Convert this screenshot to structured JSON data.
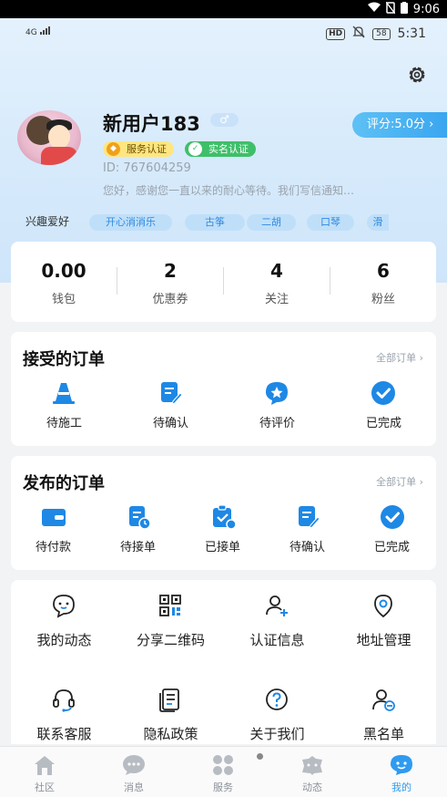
{
  "system_bar": {
    "time": "9:06"
  },
  "status": {
    "signal": "4G",
    "hd": "HD",
    "battery": "58",
    "time": "5:31"
  },
  "profile": {
    "name": "新用户183",
    "gender_symbol": "♂",
    "badges": {
      "service": "服务认证",
      "real_name": "实名认证"
    },
    "uid": "ID: 767604259",
    "signature": "您好，感谢您一直以来的耐心等待。我们写信通知…",
    "score": "评分:5.0分 ›"
  },
  "hobbies": {
    "label": "兴趣爱好",
    "tags": [
      "开心消消乐",
      "古筝",
      "二胡",
      "口琴",
      "滑"
    ]
  },
  "stats": [
    {
      "value": "0.00",
      "label": "钱包"
    },
    {
      "value": "2",
      "label": "优惠券"
    },
    {
      "value": "4",
      "label": "关注"
    },
    {
      "value": "6",
      "label": "粉丝"
    }
  ],
  "received_orders": {
    "title": "接受的订单",
    "all_link": "全部订单  ›",
    "items": [
      {
        "label": "待施工",
        "icon": "traffic-cone-icon"
      },
      {
        "label": "待确认",
        "icon": "edit-document-icon"
      },
      {
        "label": "待评价",
        "icon": "star-bubble-icon"
      },
      {
        "label": "已完成",
        "icon": "check-circle-icon"
      }
    ]
  },
  "published_orders": {
    "title": "发布的订单",
    "all_link": "全部订单  ›",
    "items": [
      {
        "label": "待付款",
        "icon": "wallet-icon"
      },
      {
        "label": "待接单",
        "icon": "clock-document-icon"
      },
      {
        "label": "已接单",
        "icon": "clipboard-icon"
      },
      {
        "label": "待确认",
        "icon": "edit-document-icon"
      },
      {
        "label": "已完成",
        "icon": "check-circle-icon"
      }
    ]
  },
  "tools": [
    {
      "label": "我的动态",
      "icon": "chat-face-icon"
    },
    {
      "label": "分享二维码",
      "icon": "qr-code-icon"
    },
    {
      "label": "认证信息",
      "icon": "user-add-icon"
    },
    {
      "label": "地址管理",
      "icon": "location-icon"
    },
    {
      "label": "联系客服",
      "icon": "headset-icon"
    },
    {
      "label": "隐私政策",
      "icon": "document-icon"
    },
    {
      "label": "关于我们",
      "icon": "question-icon"
    },
    {
      "label": "黑名单",
      "icon": "user-block-icon"
    }
  ],
  "tabbar": [
    {
      "label": "社区",
      "icon": "home-icon"
    },
    {
      "label": "消息",
      "icon": "message-icon"
    },
    {
      "label": "服务",
      "icon": "grid-icon"
    },
    {
      "label": "动态",
      "icon": "moments-icon"
    },
    {
      "label": "我的",
      "icon": "me-icon",
      "active": true
    }
  ],
  "colors": {
    "accent": "#2f9bf0",
    "hero_bg": "#d6eafb",
    "icon_blue": "#1e88e5"
  }
}
